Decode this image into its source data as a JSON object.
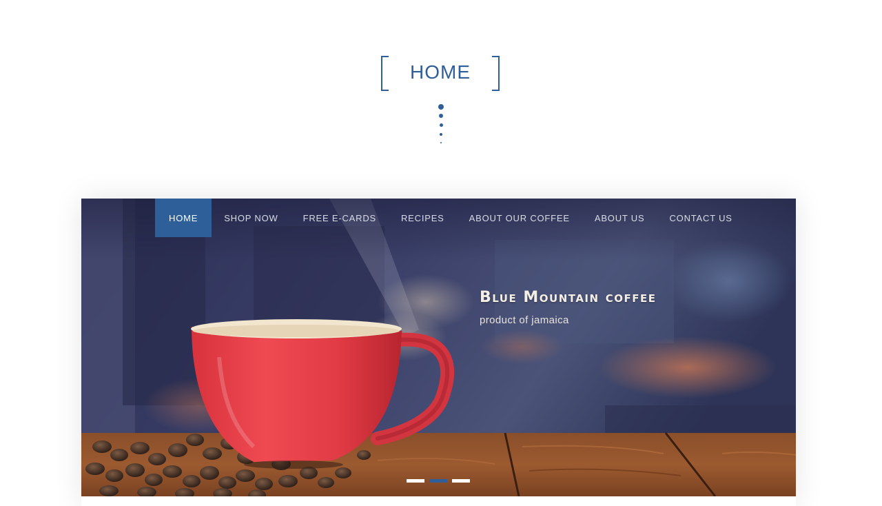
{
  "section": {
    "title": "HOME"
  },
  "nav": {
    "items": [
      {
        "label": "HOME",
        "active": true
      },
      {
        "label": "SHOP NOW",
        "active": false
      },
      {
        "label": "FREE E-CARDS",
        "active": false
      },
      {
        "label": "RECIPES",
        "active": false
      },
      {
        "label": "ABOUT OUR COFFEE",
        "active": false
      },
      {
        "label": "ABOUT US",
        "active": false
      },
      {
        "label": "CONTACT US",
        "active": false
      }
    ]
  },
  "hero": {
    "title": "Blue Mountain coffee",
    "subtitle": "product of jamaica",
    "slides_total": 3,
    "active_slide": 2
  },
  "colors": {
    "accent": "#2f5f98",
    "indicator_inactive": "#ffffff",
    "nav_text": "#d9dce6"
  }
}
